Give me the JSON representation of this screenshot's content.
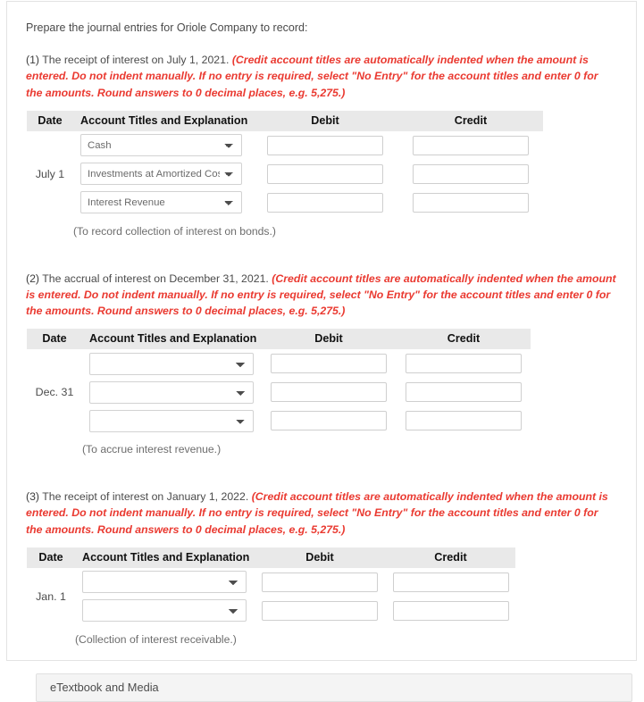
{
  "prompt": "Prepare the journal entries for Oriole Company to record:",
  "columns": {
    "date": "Date",
    "account": "Account Titles and Explanation",
    "debit": "Debit",
    "credit": "Credit"
  },
  "hint_text": "(Credit account titles are automatically indented when the amount is entered. Do not indent manually. If no entry is required, select \"No Entry\" for the account titles and enter 0 for the amounts. Round answers to 0 decimal places, e.g. 5,275.)",
  "entries": [
    {
      "number": "(1)",
      "text": " The receipt of interest on July 1, 2021. ",
      "hint": "(Credit account titles are automatically indented when the amount is entered. Do not indent manually. If no entry is required, select \"No Entry\" for the account titles and enter 0 for the amounts. Round answers to 0 decimal places, e.g. 5,275.)",
      "date": "July 1",
      "memo": "(To record collection of interest on bonds.)",
      "rows": [
        {
          "account": "Cash",
          "debit": "",
          "credit": ""
        },
        {
          "account": "Investments at Amortized Cost",
          "debit": "",
          "credit": ""
        },
        {
          "account": "Interest Revenue",
          "debit": "",
          "credit": ""
        }
      ]
    },
    {
      "number": "(2)",
      "text": " The accrual of interest on December 31, 2021. ",
      "hint": "(Credit account titles are automatically indented when the amount is entered. Do not indent manually. If no entry is required, select \"No Entry\" for the account titles and enter 0 for the amounts. Round answers to 0 decimal places, e.g. 5,275.)",
      "date": "Dec. 31",
      "memo": "(To accrue interest revenue.)",
      "rows": [
        {
          "account": "",
          "debit": "",
          "credit": ""
        },
        {
          "account": "",
          "debit": "",
          "credit": ""
        },
        {
          "account": "",
          "debit": "",
          "credit": ""
        }
      ]
    },
    {
      "number": "(3)",
      "text": " The receipt of interest on January 1, 2022. ",
      "hint": "(Credit account titles are automatically indented when the amount is entered. Do not indent manually. If no entry is required, select \"No Entry\" for the account titles and enter 0 for the amounts. Round answers to 0 decimal places, e.g. 5,275.)",
      "date": "Jan. 1",
      "memo": "(Collection of interest receivable.)",
      "rows": [
        {
          "account": "",
          "debit": "",
          "credit": ""
        },
        {
          "account": "",
          "debit": "",
          "credit": ""
        }
      ]
    }
  ],
  "etextbook": {
    "label": "eTextbook and Media"
  },
  "colors": {
    "hint_red": "#ea3a31",
    "header_bg": "#e9e9e9",
    "body_text": "#4a4a4a"
  }
}
